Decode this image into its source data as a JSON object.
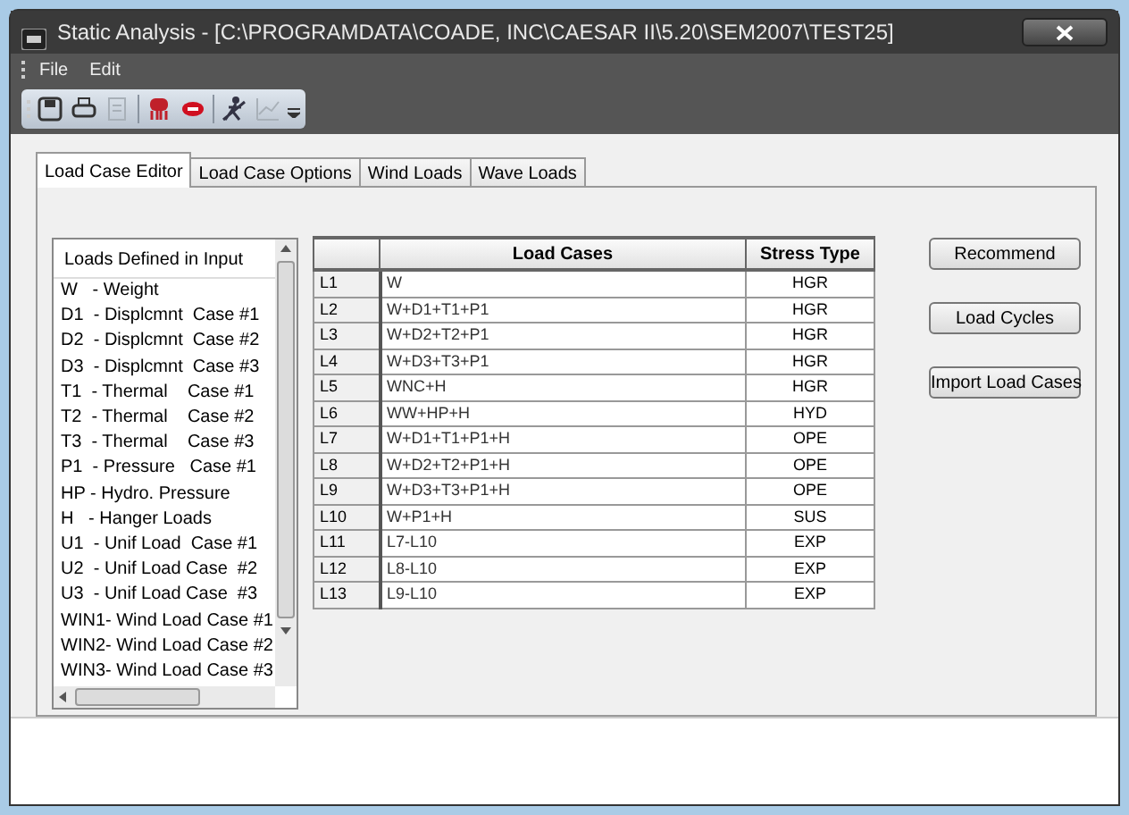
{
  "window": {
    "title": "Static Analysis - [C:\\PROGRAMDATA\\COADE, INC\\CAESAR II\\5.20\\SEM2007\\TEST25]"
  },
  "menu": [
    "File",
    "Edit"
  ],
  "toolbar": [
    {
      "kind": "save",
      "disabled": false
    },
    {
      "kind": "print",
      "disabled": false
    },
    {
      "kind": "copy",
      "disabled": true
    },
    {
      "kind": "robot",
      "disabled": false
    },
    {
      "kind": "blob",
      "disabled": false
    },
    {
      "kind": "figure",
      "disabled": false
    },
    {
      "kind": "chart",
      "disabled": true
    }
  ],
  "tabs": [
    {
      "label": "Load Case Editor",
      "selected": true
    },
    {
      "label": "Load Case Options",
      "selected": false
    },
    {
      "label": "Wind Loads",
      "selected": false
    },
    {
      "label": "Wave Loads",
      "selected": false
    }
  ],
  "loads_list": {
    "header": "Loads Defined in Input",
    "items": [
      "W   - Weight",
      "D1  - Displcmnt  Case #1",
      "D2  - Displcmnt  Case #2",
      "D3  - Displcmnt  Case #3",
      "T1  - Thermal    Case #1",
      "T2  - Thermal    Case #2",
      "T3  - Thermal    Case #3",
      "P1  - Pressure   Case #1",
      "HP - Hydro. Pressure",
      "H   - Hanger Loads",
      "U1  - Unif Load  Case #1",
      "U2  - Unif Load Case  #2",
      "U3  - Unif Load Case  #3",
      "WIN1- Wind Load Case #1",
      "WIN2- Wind Load Case #2",
      "WIN3- Wind Load Case #3"
    ]
  },
  "table": {
    "columns": [
      "Load Cases",
      "Stress Type"
    ],
    "rows": [
      {
        "id": "L1",
        "load_case": "W",
        "stress_type": "HGR"
      },
      {
        "id": "L2",
        "load_case": "W+D1+T1+P1",
        "stress_type": "HGR"
      },
      {
        "id": "L3",
        "load_case": "W+D2+T2+P1",
        "stress_type": "HGR"
      },
      {
        "id": "L4",
        "load_case": "W+D3+T3+P1",
        "stress_type": "HGR"
      },
      {
        "id": "L5",
        "load_case": "WNC+H",
        "stress_type": "HGR"
      },
      {
        "id": "L6",
        "load_case": "WW+HP+H",
        "stress_type": "HYD"
      },
      {
        "id": "L7",
        "load_case": "W+D1+T1+P1+H",
        "stress_type": "OPE"
      },
      {
        "id": "L8",
        "load_case": "W+D2+T2+P1+H",
        "stress_type": "OPE"
      },
      {
        "id": "L9",
        "load_case": "W+D3+T3+P1+H",
        "stress_type": "OPE"
      },
      {
        "id": "L10",
        "load_case": "W+P1+H",
        "stress_type": "SUS"
      },
      {
        "id": "L11",
        "load_case": "L7-L10",
        "stress_type": "EXP"
      },
      {
        "id": "L12",
        "load_case": "L8-L10",
        "stress_type": "EXP"
      },
      {
        "id": "L13",
        "load_case": "L9-L10",
        "stress_type": "EXP"
      }
    ]
  },
  "buttons": [
    "Recommend",
    "Load Cycles",
    "Import Load Cases"
  ]
}
